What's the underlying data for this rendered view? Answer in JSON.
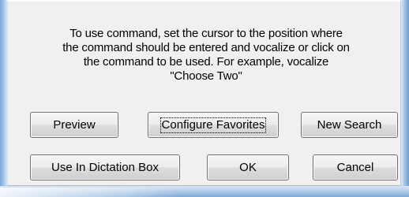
{
  "dialog": {
    "message_lines": [
      "To use command, set the cursor to the position where",
      "the command should be entered and vocalize or click on",
      "the command to be used. For example, vocalize",
      "\"Choose Two\""
    ],
    "buttons": {
      "preview": "Preview",
      "configure_favorites": "Configure Favorites",
      "new_search": "New Search",
      "use_in_dictation_box": "Use In Dictation Box",
      "ok": "OK",
      "cancel": "Cancel"
    },
    "focused_button": "configure_favorites"
  },
  "colors": {
    "dialog_background": "#f0f0f0",
    "window_frame": "#7aa9d6",
    "button_border": "#707070"
  }
}
